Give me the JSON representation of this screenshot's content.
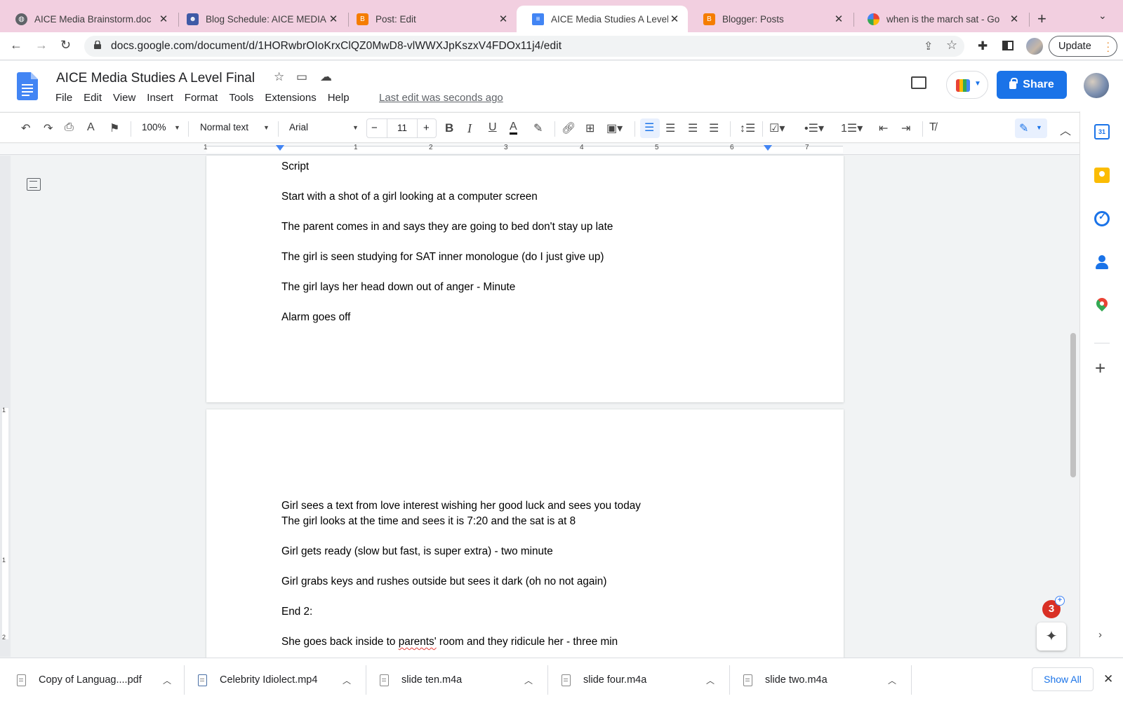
{
  "browser": {
    "tabs": [
      {
        "title": "AICE Media Brainstorm.doc",
        "favicon": "globe-icon"
      },
      {
        "title": "Blog Schedule: AICE MEDIA",
        "favicon": "blog-icon"
      },
      {
        "title": "Post: Edit",
        "favicon": "blogger-icon"
      },
      {
        "title": "AICE Media Studies A Level",
        "favicon": "docs-icon",
        "active": true
      },
      {
        "title": "Blogger: Posts",
        "favicon": "blogger-icon"
      },
      {
        "title": "when is the march sat - Go",
        "favicon": "google-icon"
      }
    ],
    "url": "docs.google.com/document/d/1HORwbrOIoKrxClQZ0MwD8-vlWWXJpKszxV4FDOx11j4/edit",
    "update_label": "Update"
  },
  "doc": {
    "title": "AICE Media Studies A Level Final",
    "menus": [
      "File",
      "Edit",
      "View",
      "Insert",
      "Format",
      "Tools",
      "Extensions",
      "Help"
    ],
    "last_edit": "Last edit was seconds ago",
    "share_label": "Share"
  },
  "format_toolbar": {
    "zoom": "100%",
    "style": "Normal text",
    "font": "Arial",
    "font_size": "11"
  },
  "ruler": {
    "top_numbers": [
      "1",
      "1",
      "2",
      "3",
      "4",
      "5",
      "6",
      "7"
    ],
    "left_numbers": [
      "1",
      "1",
      "2"
    ]
  },
  "pages": [
    {
      "lines": [
        "Script",
        "Start with a shot of a girl looking at a computer screen",
        "The parent comes in and says they are going to bed don't stay up late",
        "The girl is seen studying for SAT inner monologue (do I just give up)",
        "The girl lays her head down out of anger - Minute",
        "Alarm goes off"
      ]
    },
    {
      "lines": [
        "Girl sees a text from love interest wishing her good luck and sees you today",
        "The girl looks at the time and sees it is 7:20 and the sat is at 8",
        "Girl gets ready (slow but fast, is super extra) - two minute",
        "Girl grabs keys and rushes outside but sees it dark (oh no not again)",
        "End 2:"
      ],
      "last_line": {
        "before": "She goes back inside to ",
        "misspelled": "parents'",
        "after": " room and they ridicule her - three min"
      }
    }
  ],
  "side_panel": {
    "calendar_day": "31"
  },
  "notifications": {
    "count": "3"
  },
  "downloads": {
    "items": [
      "Copy of Languag....pdf",
      "Celebrity Idiolect.mp4",
      "slide ten.m4a",
      "slide four.m4a",
      "slide two.m4a"
    ],
    "show_all": "Show All"
  }
}
